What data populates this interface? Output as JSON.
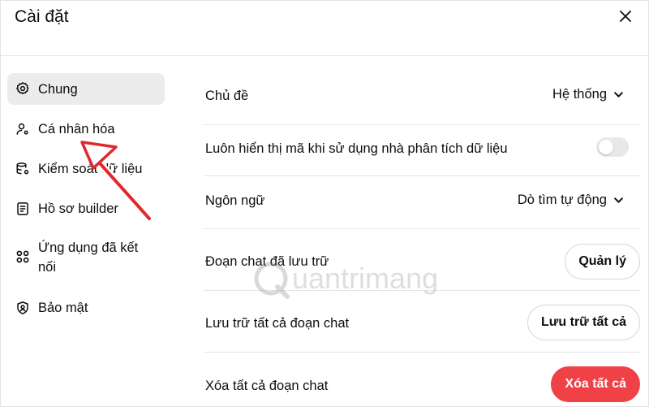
{
  "window": {
    "title": "Cài đặt"
  },
  "icons": {
    "close": "close-icon"
  },
  "sidebar": {
    "items": [
      {
        "label": "Chung",
        "icon": "gear-icon",
        "active": true
      },
      {
        "label": "Cá nhân hóa",
        "icon": "user-customize-icon",
        "active": false
      },
      {
        "label": "Kiểm soát dữ liệu",
        "icon": "database-settings-icon",
        "active": false
      },
      {
        "label": "Hồ sơ builder",
        "icon": "profile-card-icon",
        "active": false
      },
      {
        "label": "Ứng dụng đã kết nối",
        "icon": "apps-grid-icon",
        "active": false
      },
      {
        "label": "Bảo mật",
        "icon": "shield-lock-icon",
        "active": false
      }
    ]
  },
  "settings": {
    "theme": {
      "label": "Chủ đề",
      "value": "Hệ thống"
    },
    "show_code": {
      "label": "Luôn hiển thị mã khi sử dụng nhà phân tích dữ liệu",
      "enabled": false
    },
    "language": {
      "label": "Ngôn ngữ",
      "value": "Dò tìm tự động"
    },
    "archived_chats": {
      "label": "Đoạn chat đã lưu trữ",
      "button": "Quản lý"
    },
    "archive_all": {
      "label": "Lưu trữ tất cả đoạn chat",
      "button": "Lưu trữ tất cả"
    },
    "delete_all": {
      "label": "Xóa tất cả đoạn chat",
      "button": "Xóa tất cả"
    }
  },
  "colors": {
    "danger": "#ef4146",
    "active_bg": "#ececec",
    "annotation": "#e0282e"
  },
  "watermark": {
    "text": "uantrimang"
  }
}
